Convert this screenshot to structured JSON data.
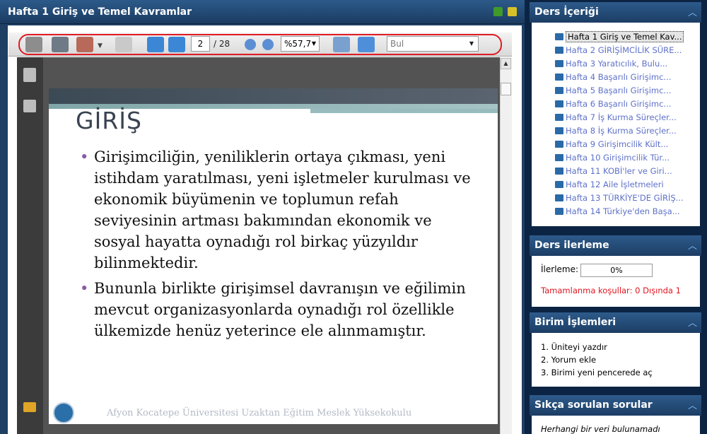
{
  "window": {
    "title": "Hafta 1 Giriş ve Temel Kavramlar"
  },
  "toolbar": {
    "page_current": "2",
    "page_total": "/ 28",
    "zoom": "%57,7",
    "find_placeholder": "Bul"
  },
  "slide": {
    "title": "GİRİŞ",
    "bullets": [
      "Girişimciliğin, yeniliklerin ortaya çıkması, yeni istihdam yaratılması, yeni işletmeler kurulması ve ekonomik büyümenin ve toplumun refah seviyesinin artması bakımından ekonomik ve sosyal hayatta oynadığı rol birkaç yüzyıldır bilinmektedir.",
      "Bununla birlikte girişimsel davranışın ve eğilimin mevcut organizasyonlarda oynadığı rol özellikle ülkemizde henüz yeterince ele alınmamıştır."
    ],
    "footer": "Afyon Kocatepe Üniversitesi Uzaktan Eğitim Meslek Yüksekokulu"
  },
  "course_content": {
    "title": "Ders İçeriği",
    "items": [
      "Hafta 1 Giriş ve Temel Kav...",
      "Hafta 2 GİRİŞİMCİLİK SÜRE...",
      "Hafta 3 Yaratıcılık, Bulu...",
      "Hafta 4 Başarılı Girişimc...",
      "Hafta 5 Başarılı Girişimc...",
      "Hafta 6 Başarılı Girişimc...",
      "Hafta 7 İş Kurma Süreçler...",
      "Hafta 8 İş Kurma Süreçler...",
      "Hafta 9 Girişimcilik Kült...",
      "Hafta 10 Girişimcilik Tür...",
      "Hafta 11 KOBİ'ler ve Giri...",
      "Hafta 12 Aile İşletmeleri",
      "Hafta 13 TÜRKİYE'DE GİRİŞ...",
      "Hafta 14 Türkiye'den Başa..."
    ]
  },
  "course_progress": {
    "title": "Ders ilerleme",
    "label": "İlerleme:",
    "value": "0%",
    "conditions": "Tamamlanma koşullar: 0 Dışında 1"
  },
  "unit_ops": {
    "title": "Birim İşlemleri",
    "items": [
      "1. Üniteyi yazdır",
      "2. Yorum ekle",
      "3. Birimi yeni pencerede aç"
    ]
  },
  "faq": {
    "title": "Sıkça sorulan sorular",
    "empty": "Herhangi bir veri bulunamadı"
  }
}
